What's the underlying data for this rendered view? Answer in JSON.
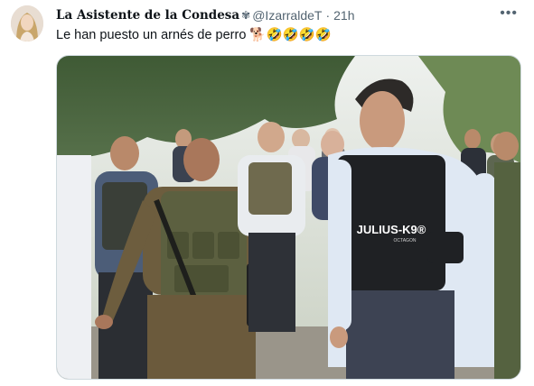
{
  "tweet": {
    "display_name": "La Asistente de la Condesa",
    "name_badge": "✾",
    "handle": "@IzarraldeT",
    "separator": "·",
    "time": "21h",
    "more_icon": "ellipsis-icon",
    "text": "Le han puesto un arnés de perro 🐕🤣🤣🤣🤣"
  },
  "media": {
    "vest_label": "JULIUS-K9®",
    "vest_sublabel": "OCTAGON"
  }
}
